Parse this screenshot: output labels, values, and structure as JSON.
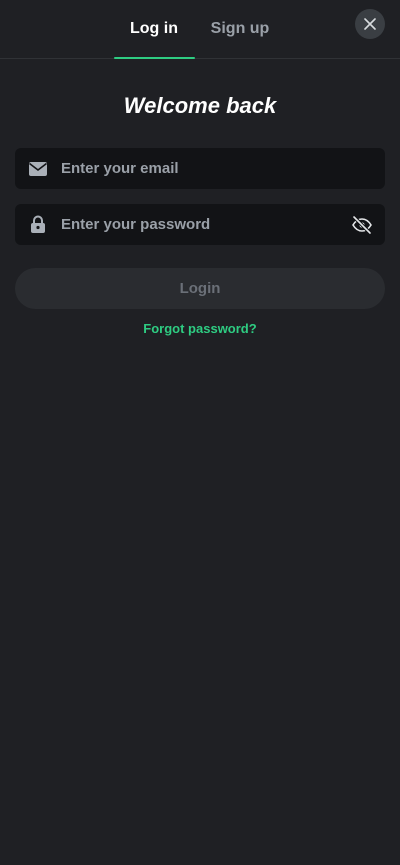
{
  "tabs": {
    "login": "Log in",
    "signup": "Sign up"
  },
  "title": "Welcome back",
  "email_field": {
    "placeholder": "Enter your email",
    "icon": "envelope-icon"
  },
  "password_field": {
    "placeholder": "Enter your password",
    "icon": "lock-icon",
    "toggle_icon": "eye-slash-icon"
  },
  "login_button": "Login",
  "forgot_link": "Forgot password?",
  "close_icon": "close-icon",
  "colors": {
    "background": "#1f2024",
    "accent": "#2ecc82",
    "input_bg": "#121316",
    "button_bg": "#2a2c30",
    "muted_text": "#9aa0a8"
  }
}
